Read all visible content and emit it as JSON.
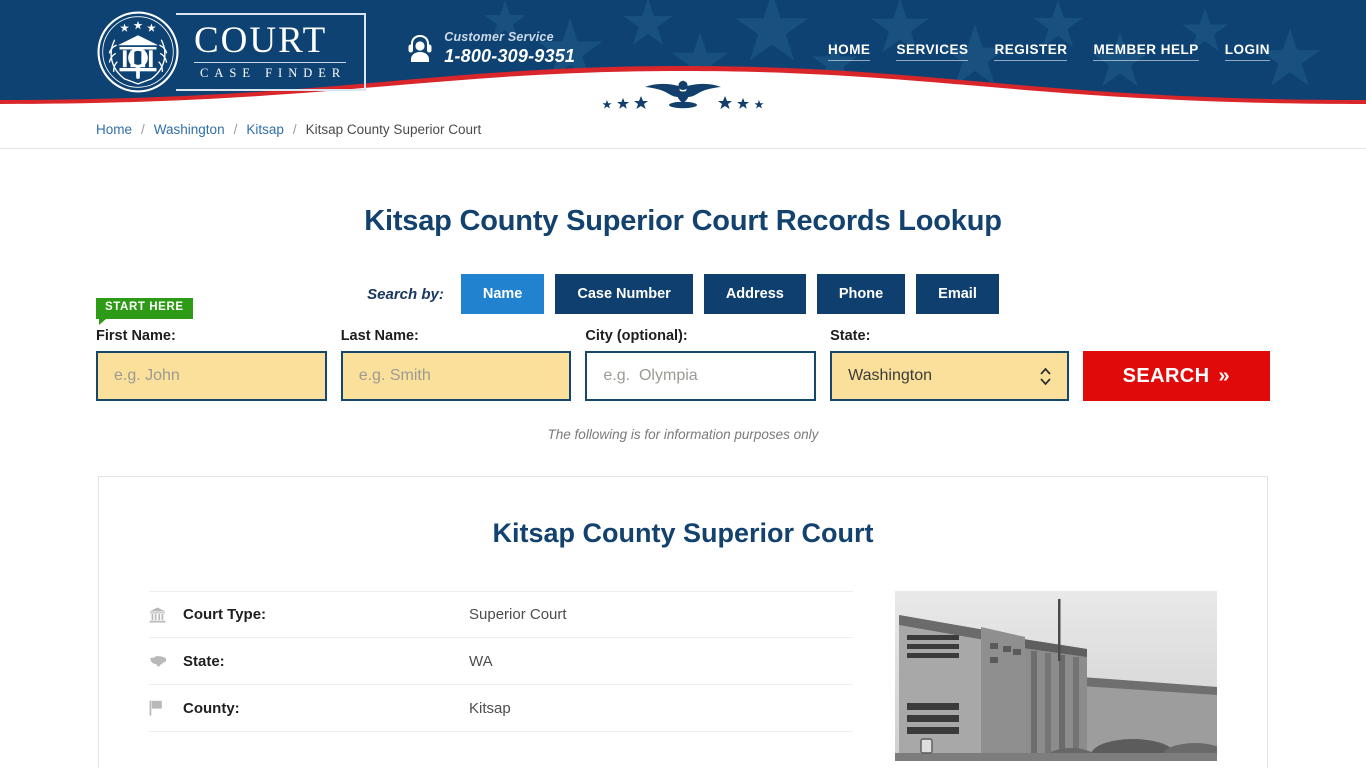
{
  "header": {
    "logo": {
      "emblem_icon": "court-seal-icon",
      "title": "COURT",
      "subtitle": "CASE FINDER"
    },
    "customer_service": {
      "icon": "headset-support-icon",
      "label": "Customer Service",
      "phone": "1-800-309-9351"
    },
    "nav": [
      {
        "label": "HOME"
      },
      {
        "label": "SERVICES"
      },
      {
        "label": "REGISTER"
      },
      {
        "label": "MEMBER HELP"
      },
      {
        "label": "LOGIN"
      }
    ],
    "colors": {
      "navy": "#0d4273",
      "red": "#d8262a",
      "white": "#ffffff"
    }
  },
  "breadcrumb": {
    "items": [
      {
        "label": "Home",
        "link": true
      },
      {
        "label": "Washington",
        "link": true
      },
      {
        "label": "Kitsap",
        "link": true
      },
      {
        "label": "Kitsap County Superior Court",
        "link": false
      }
    ],
    "separator": "/"
  },
  "main": {
    "page_title": "Kitsap County Superior Court Records Lookup",
    "search_by_label": "Search by:",
    "tabs": [
      {
        "label": "Name",
        "active": true
      },
      {
        "label": "Case Number",
        "active": false
      },
      {
        "label": "Address",
        "active": false
      },
      {
        "label": "Phone",
        "active": false
      },
      {
        "label": "Email",
        "active": false
      }
    ],
    "start_here_badge": "START HERE",
    "form": {
      "first_name": {
        "label": "First Name:",
        "placeholder": "e.g. John",
        "value": ""
      },
      "last_name": {
        "label": "Last Name:",
        "placeholder": "e.g. Smith",
        "value": ""
      },
      "city": {
        "label": "City (optional):",
        "placeholder": "e.g.  Olympia",
        "value": ""
      },
      "state": {
        "label": "State:",
        "value": "Washington"
      },
      "search_button": "SEARCH",
      "search_button_arrow": "»"
    },
    "info_note": "The following is for information purposes only"
  },
  "court_card": {
    "title": "Kitsap County Superior Court",
    "details": [
      {
        "icon": "courthouse-icon",
        "label": "Court Type:",
        "value": "Superior Court"
      },
      {
        "icon": "us-map-icon",
        "label": "State:",
        "value": "WA"
      },
      {
        "icon": "flag-icon",
        "label": "County:",
        "value": "Kitsap"
      }
    ],
    "photo_alt": "courthouse-photo"
  }
}
